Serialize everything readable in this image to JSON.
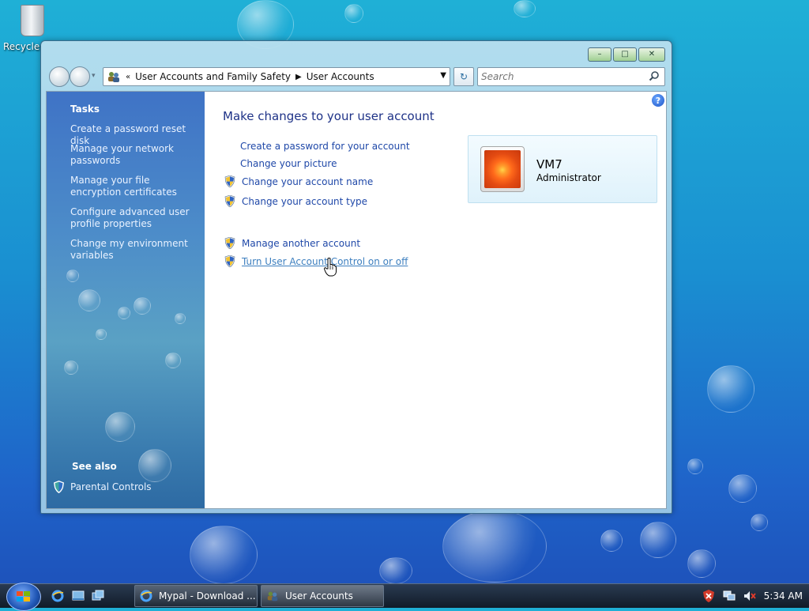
{
  "desktop": {
    "recycle_label": "Recycle"
  },
  "window": {
    "address": {
      "overflow": "«",
      "crumbs": [
        "User Accounts and Family Safety",
        "User Accounts"
      ]
    },
    "search_placeholder": "Search",
    "caption": {
      "minimize": "–",
      "maximize": "□",
      "close": "✕"
    },
    "left": {
      "tasks_title": "Tasks",
      "links": [
        "Create a password reset disk",
        "Manage your network passwords",
        "Manage your file encryption certificates",
        "Configure advanced user profile properties",
        "Change my environment variables"
      ],
      "see_also_title": "See also",
      "see_also_link": "Parental Controls"
    },
    "main": {
      "heading": "Make changes to your user account",
      "links": [
        "Create a password for your account",
        "Change your picture",
        "Change your account name",
        "Change your account type",
        "Manage another account",
        "Turn User Account Control on or off"
      ],
      "help": "?"
    },
    "user": {
      "name": "VM7",
      "role": "Administrator"
    }
  },
  "taskbar": {
    "buttons": [
      "Mypal - Download ...",
      "User Accounts"
    ],
    "clock": "5:34 AM"
  },
  "colors": {
    "link": "#1f48a8",
    "heading": "#1e3287",
    "hover_link": "#3d7fbf"
  }
}
